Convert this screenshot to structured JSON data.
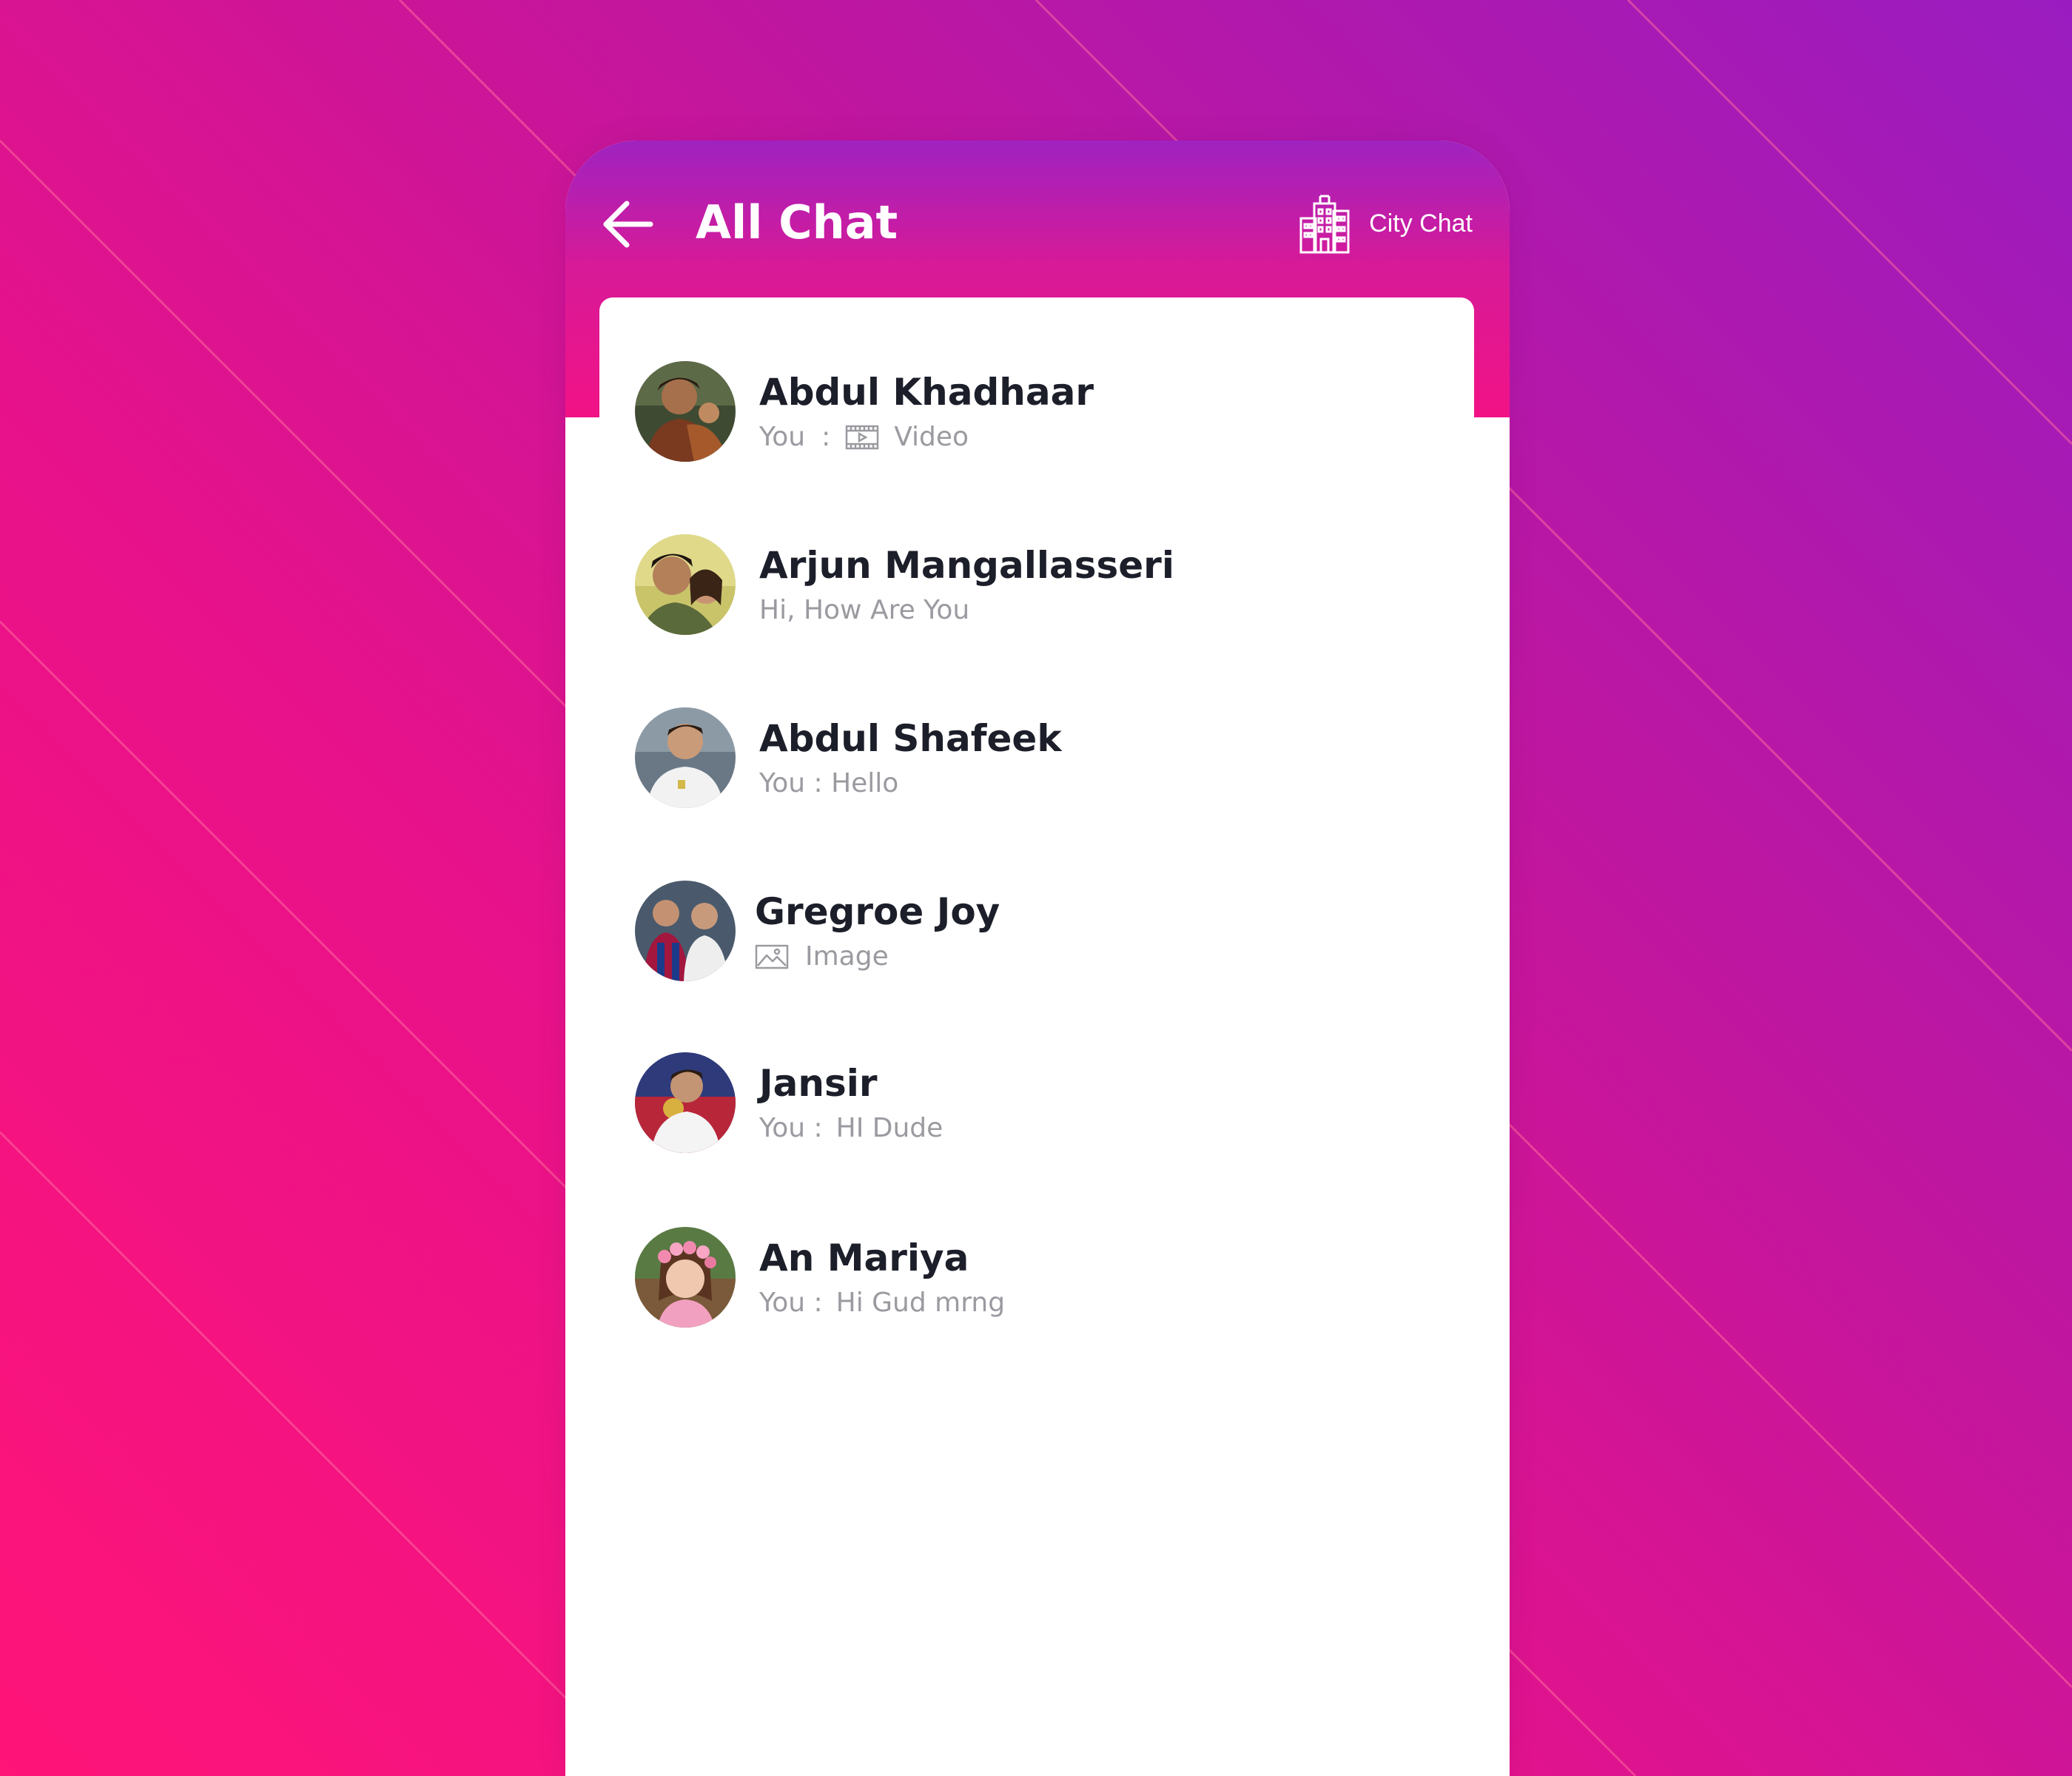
{
  "header": {
    "title": "All Chat",
    "back_icon": "arrow-left-icon",
    "city_chat": {
      "label": "City Chat",
      "icon": "building-icon"
    }
  },
  "chats": [
    {
      "name": "Abdul Khadhaar",
      "sender": "You",
      "separator": ":",
      "attachment_icon": "video-icon",
      "message": "Video"
    },
    {
      "name": "Arjun Mangallasseri",
      "message": "Hi, How Are You"
    },
    {
      "name": "Abdul Shafeek",
      "message": "You : Hello"
    },
    {
      "name": "Gregroe Joy",
      "attachment_icon": "image-icon",
      "message": "Image"
    },
    {
      "name": "Jansir",
      "sender": "You :",
      "message": "HI Dude"
    },
    {
      "name": "An Mariya",
      "sender": "You :",
      "message": "Hi Gud mrng"
    }
  ],
  "colors": {
    "header_top": "#9f22c0",
    "header_bottom": "#f21286",
    "name_text": "#1c1f2a",
    "preview_text": "#9a9aa0"
  }
}
